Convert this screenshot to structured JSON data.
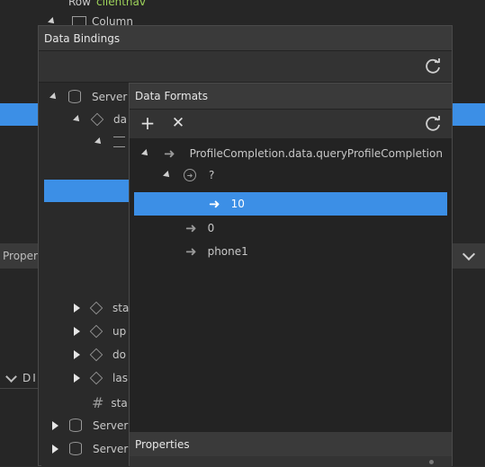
{
  "background": {
    "row_label": "Row",
    "row_value": "clientnav",
    "column_label": "Column",
    "properties_label": "Proper",
    "section_label": "DI"
  },
  "bindings": {
    "title": "Data Bindings",
    "tree": [
      {
        "label": "Server"
      },
      {
        "label": "da"
      },
      {
        "label": "sta"
      },
      {
        "label": "up"
      },
      {
        "label": "do"
      },
      {
        "label": "las"
      },
      {
        "label": "sta"
      },
      {
        "label": "Server"
      },
      {
        "label": "Server"
      }
    ]
  },
  "formats": {
    "title": "Data Formats",
    "tree": [
      {
        "label": "ProfileCompletion.data.queryProfileCompletion"
      },
      {
        "label": "?"
      },
      {
        "label": "10"
      },
      {
        "label": "0"
      },
      {
        "label": "phone1"
      }
    ],
    "properties_title": "Properties"
  },
  "colors": {
    "accent": "#3c8fe6",
    "panel": "#2a2a2a",
    "titlebar": "#3a3a3a"
  }
}
